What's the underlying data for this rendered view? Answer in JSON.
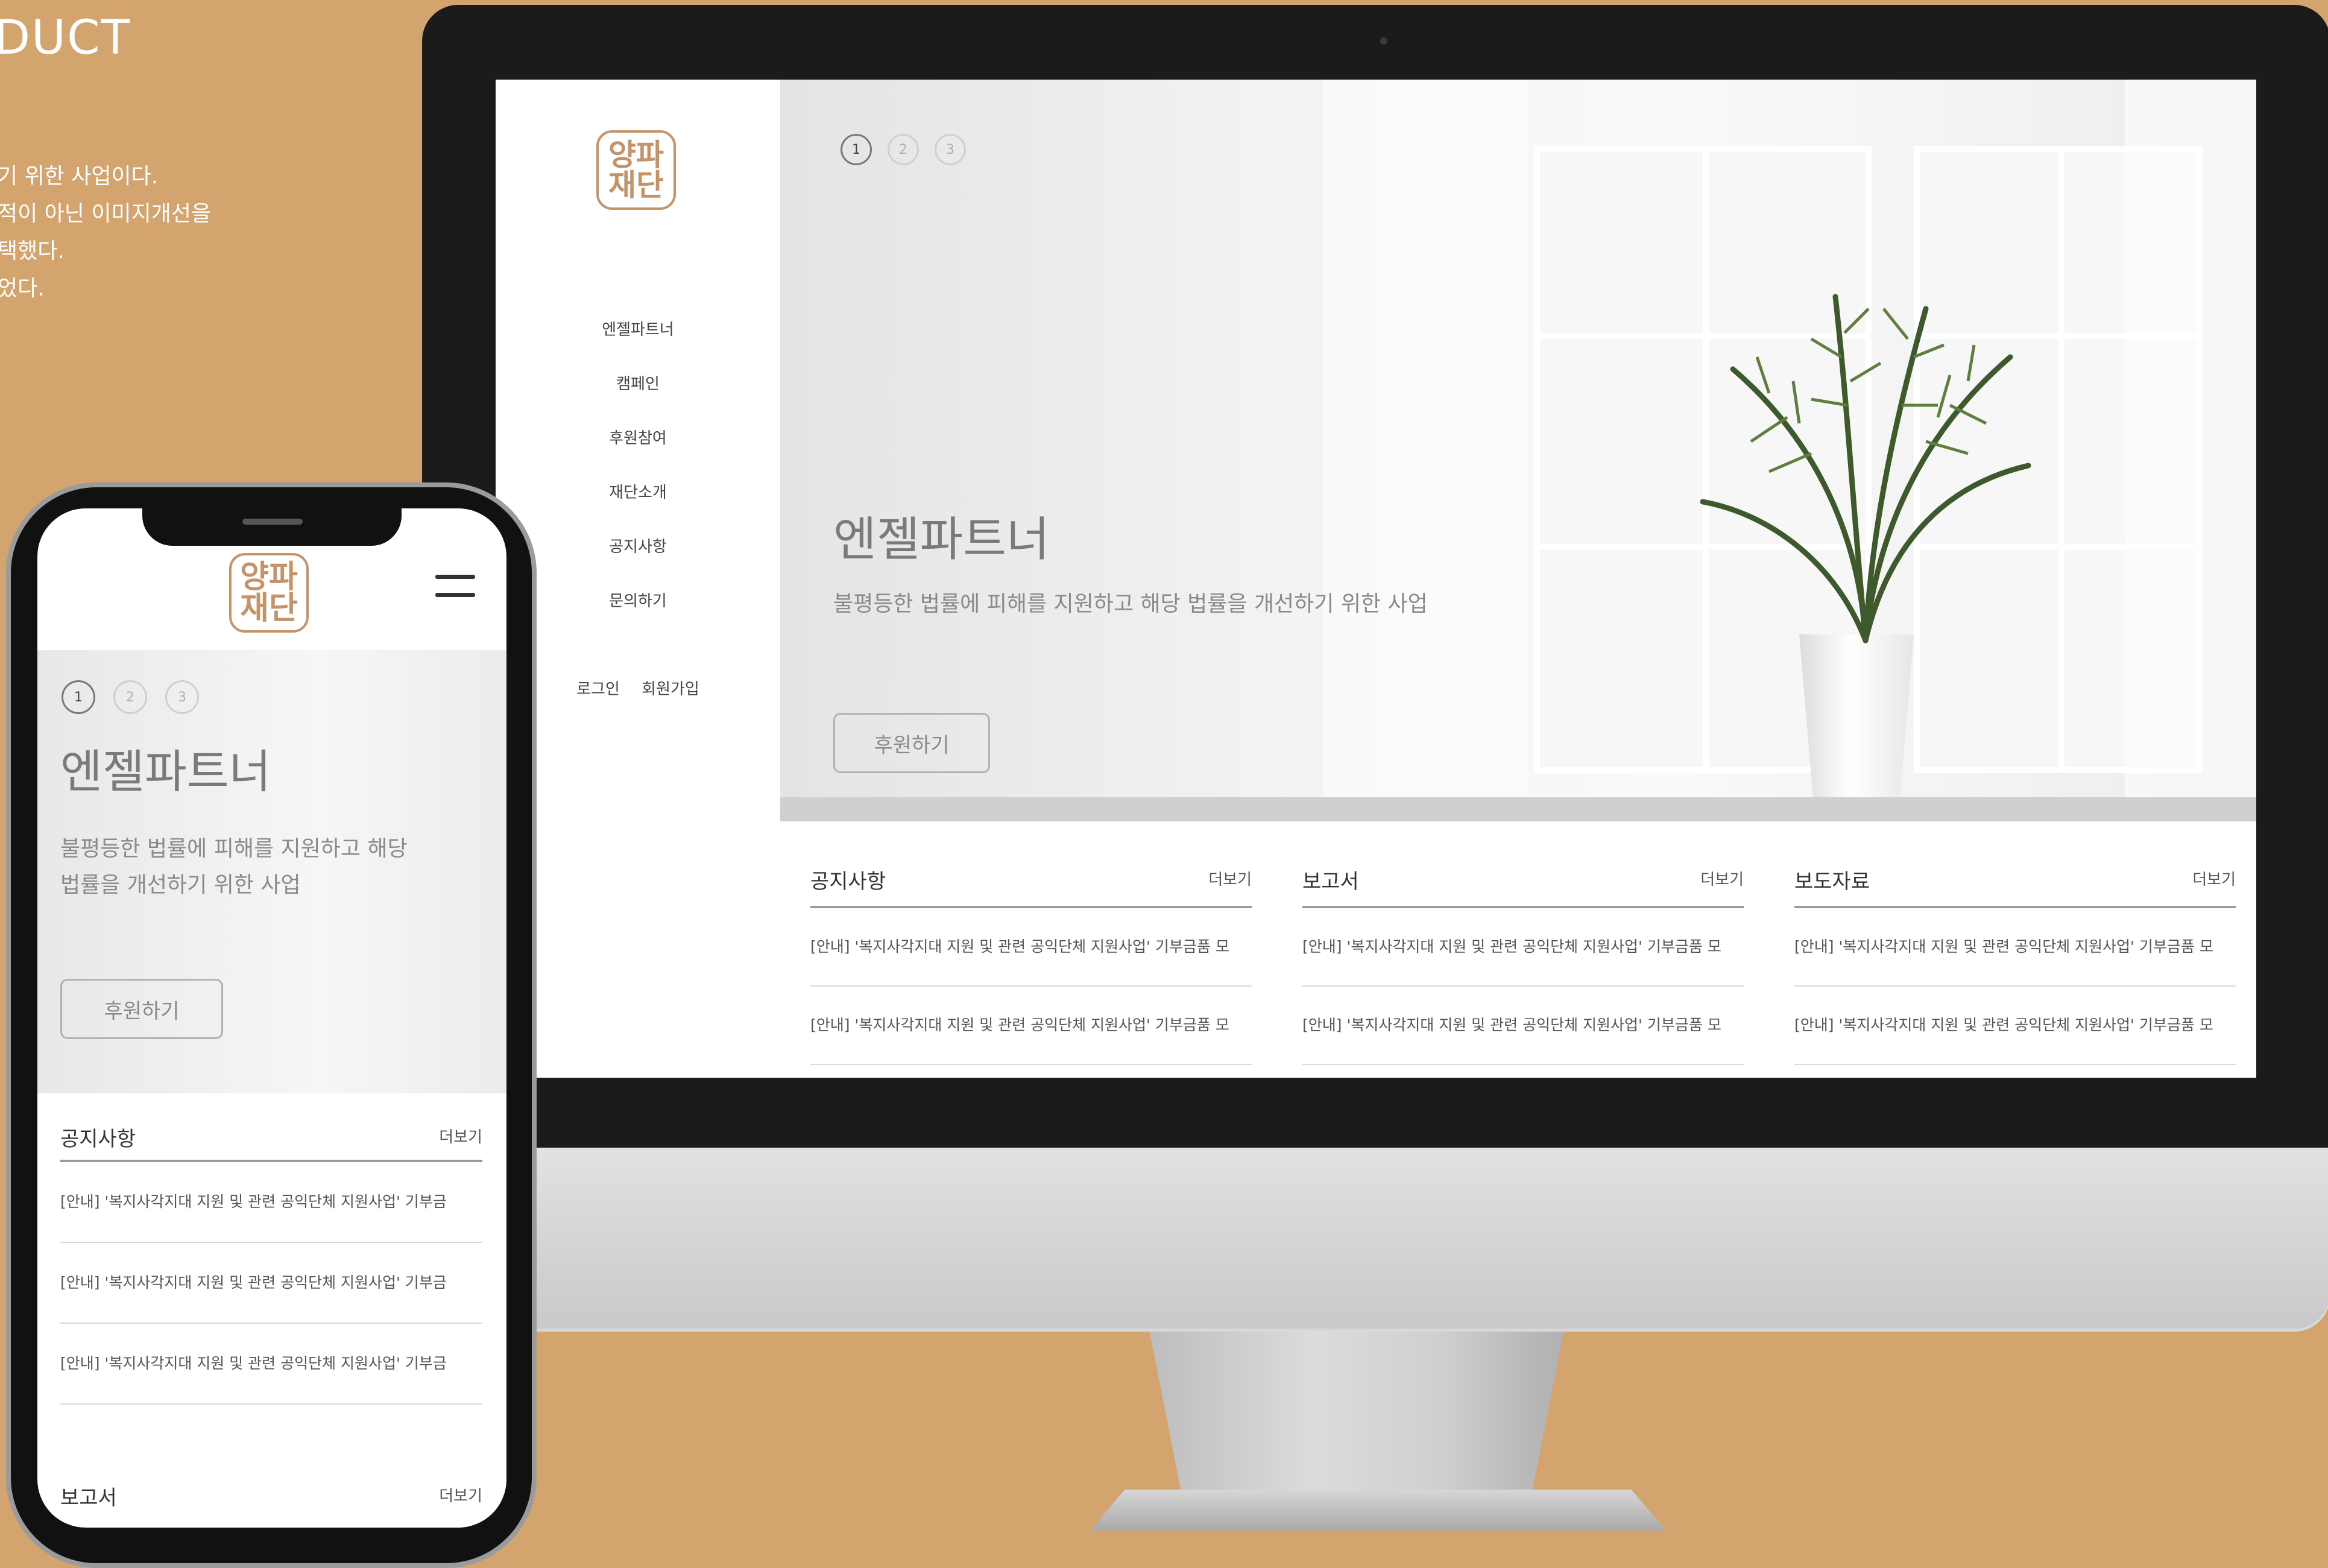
{
  "intro": {
    "title": "DUCT",
    "lines": [
      "기 위한 사업이다.",
      "적이 아닌 이미지개선을",
      "택했다.",
      "었다."
    ]
  },
  "site": {
    "logo": {
      "line1": "양파",
      "line2": "재단"
    },
    "nav": [
      "엔젤파트너",
      "캠페인",
      "후원참여",
      "재단소개",
      "공지사항",
      "문의하기"
    ],
    "auth": {
      "login": "로그인",
      "signup": "회원가입"
    },
    "hero": {
      "slides": [
        "1",
        "2",
        "3"
      ],
      "active_slide": 1,
      "title": "엔젤파트너",
      "subtitle": "불평등한 법률에 피해를 지원하고 해당 법률을 개선하기 위한 사업",
      "subtitle_mobile_1": "불평등한 법률에 피해를 지원하고 해당",
      "subtitle_mobile_2": "법률을 개선하기 위한 사업",
      "button": "후원하기"
    },
    "more_label": "더보기",
    "boards": [
      {
        "title": "공지사항",
        "rows": [
          "[안내] '복지사각지대 지원 및 관련 공익단체 지원사업' 기부금품 모",
          "[안내] '복지사각지대 지원 및 관련 공익단체 지원사업' 기부금품 모"
        ]
      },
      {
        "title": "보고서",
        "rows": [
          "[안내] '복지사각지대 지원 및 관련 공익단체 지원사업' 기부금품 모",
          "[안내] '복지사각지대 지원 및 관련 공익단체 지원사업' 기부금품 모"
        ]
      },
      {
        "title": "보도자료",
        "rows": [
          "[안내] '복지사각지대 지원 및 관련 공익단체 지원사업' 기부금품 모",
          "[안내] '복지사각지대 지원 및 관련 공익단체 지원사업' 기부금품 모"
        ]
      }
    ],
    "mobile_rows": [
      "[안내] '복지사각지대 지원 및 관련 공익단체 지원사업' 기부금",
      "[안내] '복지사각지대 지원 및 관련 공익단체 지원사업' 기부금",
      "[안내] '복지사각지대 지원 및 관련 공익단체 지원사업' 기부금"
    ]
  },
  "colors": {
    "background": "#d4a46e",
    "logo": "#c4936a",
    "text": "#444444"
  }
}
